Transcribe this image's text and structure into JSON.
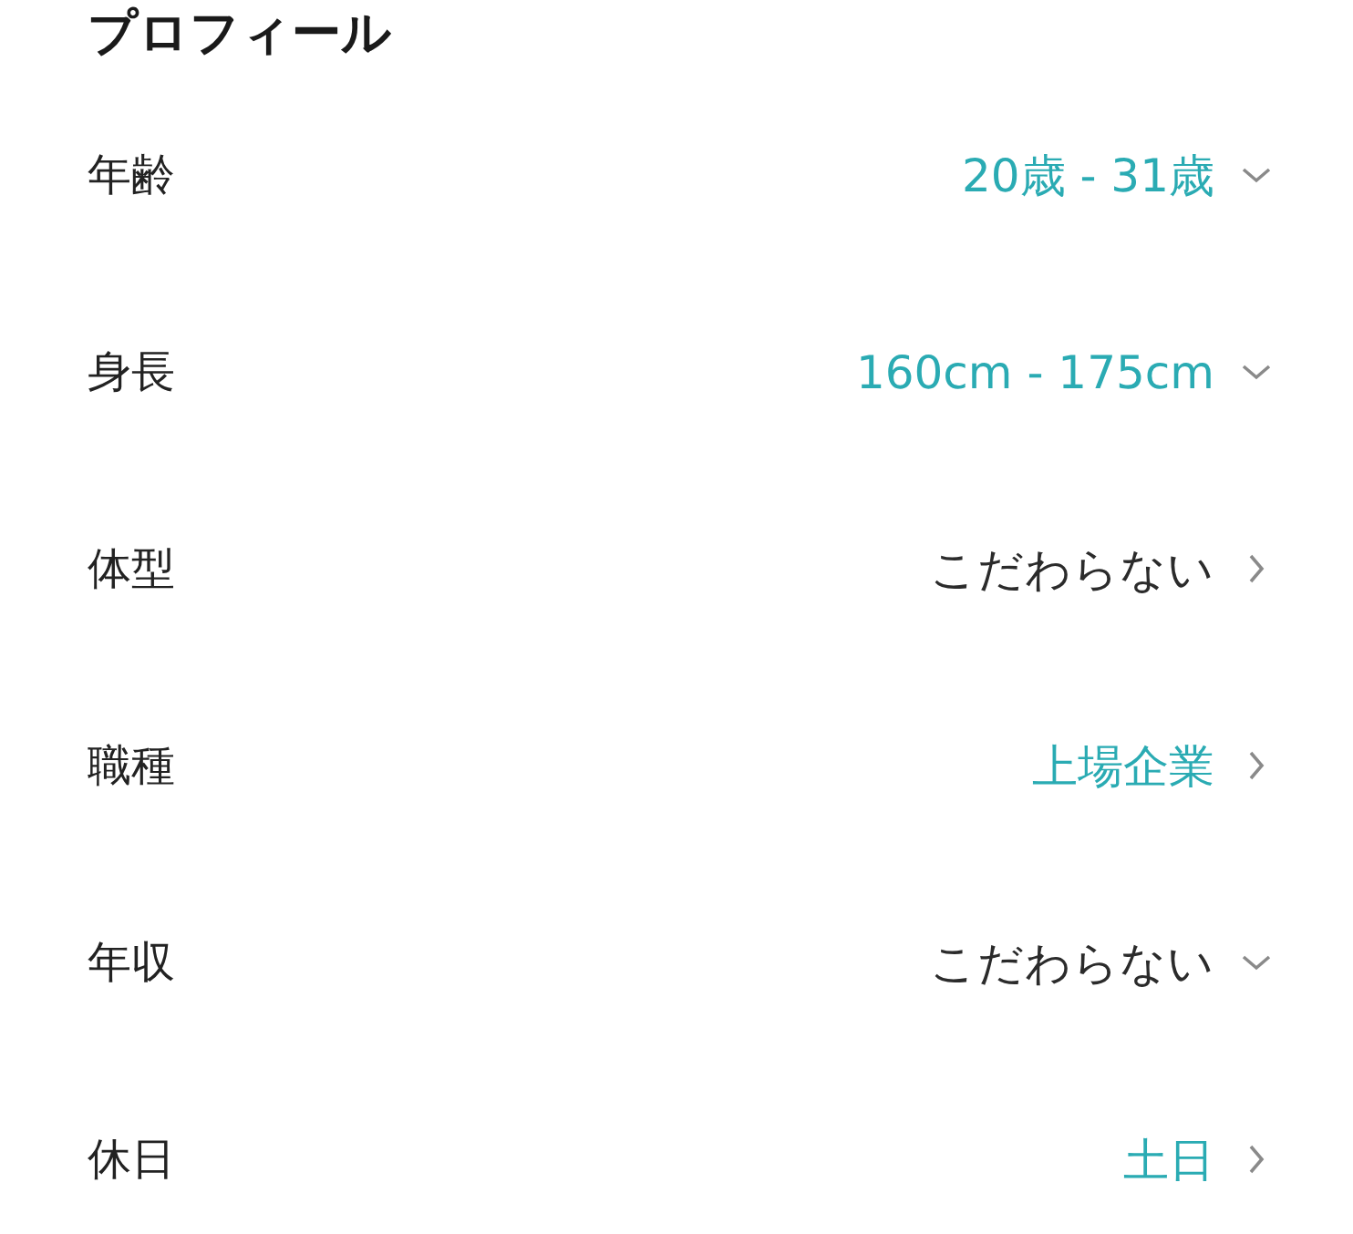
{
  "title": "プロフィール",
  "rows": [
    {
      "label": "年齢",
      "value": "20歳 - 31歳",
      "highlighted": true,
      "kind": "dropdown"
    },
    {
      "label": "身長",
      "value": "160cm - 175cm",
      "highlighted": true,
      "kind": "dropdown"
    },
    {
      "label": "体型",
      "value": "こだわらない",
      "highlighted": false,
      "kind": "link"
    },
    {
      "label": "職種",
      "value": "上場企業",
      "highlighted": true,
      "kind": "link"
    },
    {
      "label": "年収",
      "value": "こだわらない",
      "highlighted": false,
      "kind": "dropdown"
    },
    {
      "label": "休日",
      "value": "土日",
      "highlighted": true,
      "kind": "link"
    }
  ]
}
